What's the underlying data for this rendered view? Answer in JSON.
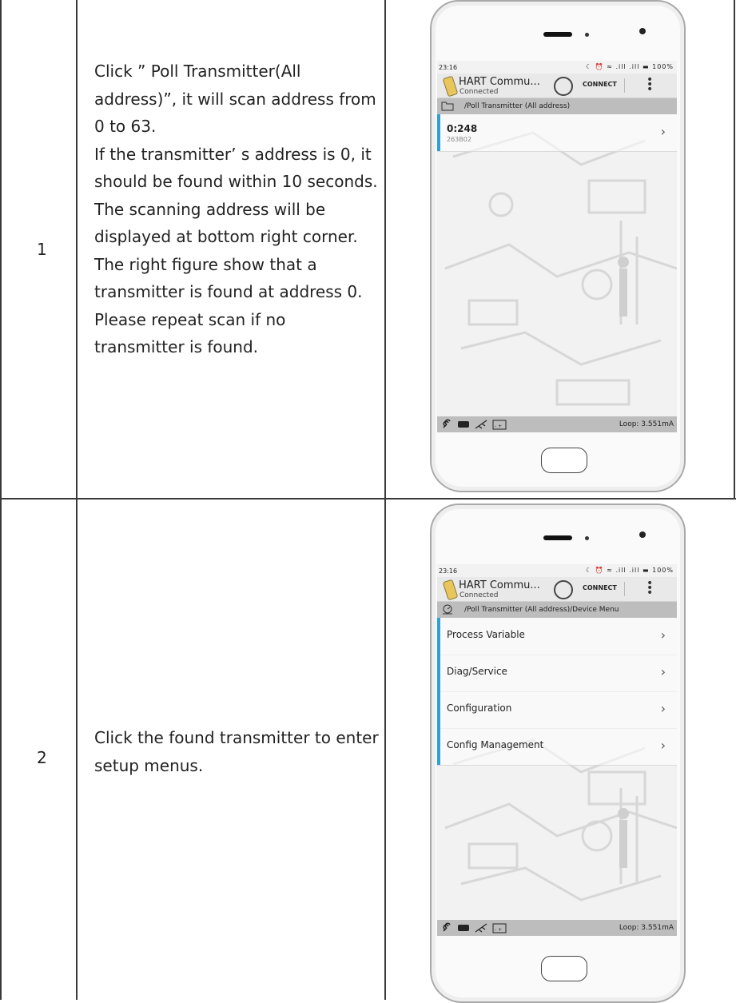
{
  "rows": [
    {
      "step": "1",
      "description": "Click ” Poll Transmitter(All address)”, it will scan address from 0 to 63.\nIf the transmitter’ s address is 0, it should be found within 10 seconds. The scanning address will be displayed at bottom right corner. The right figure show that a transmitter is found at address 0.\nPlease repeat scan if no transmitter is found.",
      "phone": {
        "time": "23:16",
        "status_icons": "☾ ⏰ ≈ .ill .ill ▬ 100%",
        "battery": "100%",
        "app_title": "HART Commu...",
        "app_status": "Connected",
        "connect_label": "CONNECT",
        "path": "/Poll Transmitter (All address)",
        "device": {
          "title": "0:248",
          "subtitle": "263B02"
        },
        "loop": "Loop: 3.551mA"
      }
    },
    {
      "step": "2",
      "description": "Click the found transmitter to enter setup menus.",
      "phone": {
        "time": "23:16",
        "status_icons": "☾ ⏰ ≈ .ill .ill ▬ 100%",
        "battery": "100%",
        "app_title": "HART Commu...",
        "app_status": "Connected",
        "connect_label": "CONNECT",
        "path": "/Poll Transmitter (All address)/Device Menu",
        "menu": [
          "Process Variable",
          "Diag/Service",
          "Configuration",
          "Config Management"
        ],
        "loop": "Loop: 3.551mA"
      }
    }
  ],
  "icons": {
    "folder": "folder-icon",
    "gauge": "gauge-icon",
    "link": "link-icon",
    "battery": "battery-icon",
    "probe": "probe-icon",
    "power": "power-icon",
    "chevron": "›",
    "more": "⋮"
  },
  "colors": {
    "accent": "#2f9fd7",
    "pathbar": "#bdbdbd",
    "grid": "#3a3a3a"
  }
}
